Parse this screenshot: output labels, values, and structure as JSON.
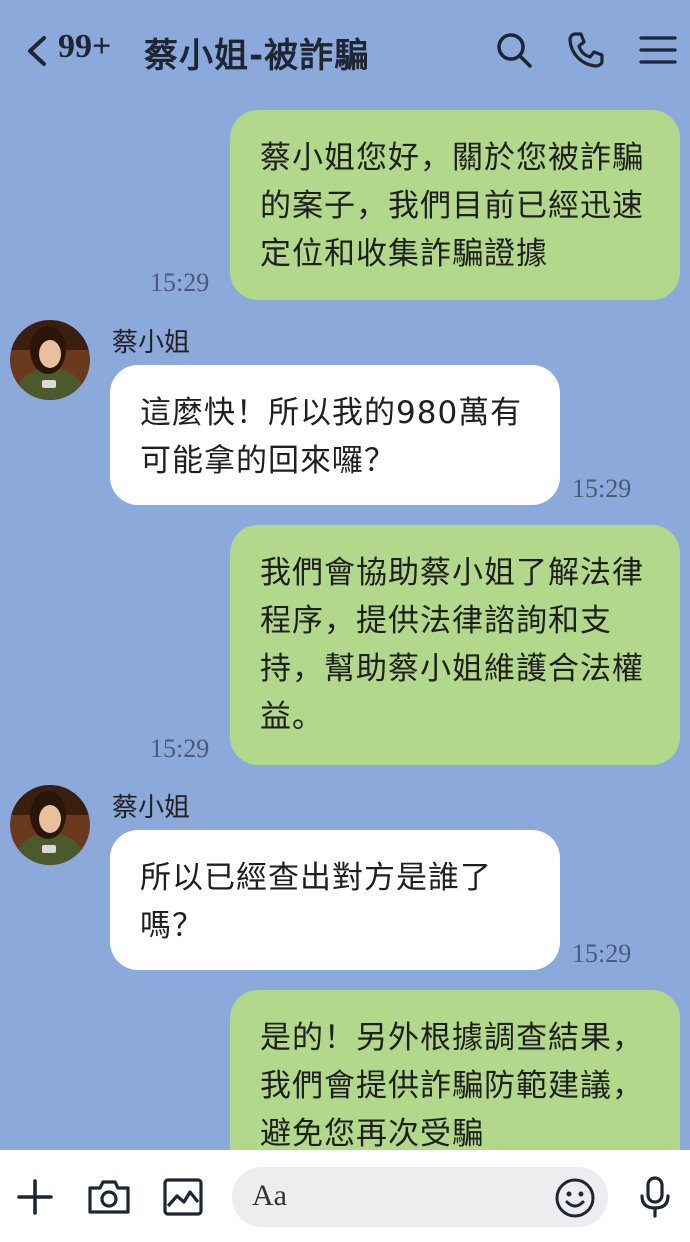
{
  "header": {
    "unread_count": "99+",
    "title": "蔡小姐-被詐騙"
  },
  "messages": [
    {
      "side": "out",
      "text": "蔡小姐您好，關於您被詐騙的案子，我們目前已經迅速定位和收集詐騙證據",
      "time": "15:29"
    },
    {
      "side": "in",
      "sender": "蔡小姐",
      "text": "這麼快！所以我的980萬有可能拿的回來囉？",
      "time": "15:29"
    },
    {
      "side": "out",
      "text": "我們會協助蔡小姐了解法律程序，提供法律諮詢和支持，幫助蔡小姐維護合法權益。",
      "time": "15:29"
    },
    {
      "side": "in",
      "sender": "蔡小姐",
      "text": "所以已經查出對方是誰了嗎？",
      "time": "15:29"
    },
    {
      "side": "out",
      "text": "是的！另外根據調查結果，我們會提供詐騙防範建議，避免您再次受騙",
      "time": ""
    }
  ],
  "input": {
    "placeholder": "Aa"
  },
  "icons": {
    "back": "chevron-left-icon",
    "search": "search-icon",
    "call": "phone-icon",
    "menu": "menu-icon",
    "add": "plus-icon",
    "camera": "camera-icon",
    "gallery": "image-icon",
    "emoji": "emoji-icon",
    "mic": "microphone-icon"
  },
  "colors": {
    "background": "#8BA9DA",
    "outgoing_bubble": "#B2D88C",
    "incoming_bubble": "#FFFFFF"
  }
}
